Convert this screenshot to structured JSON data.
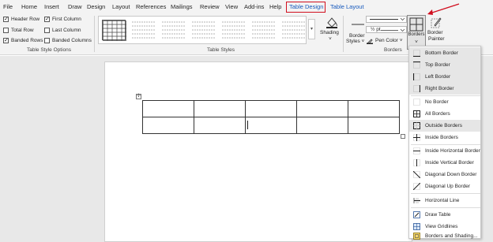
{
  "menu": {
    "items": [
      "File",
      "Home",
      "Insert",
      "Draw",
      "Design",
      "Layout",
      "References",
      "Mailings",
      "Review",
      "View",
      "Add-ins",
      "Help",
      "Table Design",
      "Table Layout"
    ]
  },
  "ribbon": {
    "style_options": {
      "header_row": "Header Row",
      "first_column": "First Column",
      "total_row": "Total Row",
      "last_column": "Last Column",
      "banded_rows": "Banded Rows",
      "banded_columns": "Banded Columns",
      "group_label": "Table Style Options"
    },
    "table_styles_label": "Table Styles",
    "shading_label": "Shading",
    "border_styles_label1": "Border",
    "border_styles_label2": "Styles ˅",
    "pen_weight": "½ pt",
    "pen_color_label": "Pen Color ˅",
    "borders_label": "Borders",
    "borders_btn_label": "Borders",
    "border_painter_label1": "Border",
    "border_painter_label2": "Painter",
    "borders_group_label": "Borders"
  },
  "dropdown": {
    "items": [
      {
        "label": "Bottom Border",
        "icon": "bottom-border-icon"
      },
      {
        "label": "Top Border",
        "icon": "top-border-icon"
      },
      {
        "label": "Left Border",
        "icon": "left-border-icon"
      },
      {
        "label": "Right Border",
        "icon": "right-border-icon"
      },
      {
        "label": "No Border",
        "icon": "no-border-icon"
      },
      {
        "label": "All Borders",
        "icon": "all-borders-icon"
      },
      {
        "label": "Outside Borders",
        "icon": "outside-borders-icon"
      },
      {
        "label": "Inside Borders",
        "icon": "inside-borders-icon"
      },
      {
        "label": "Inside Horizontal Border",
        "icon": "inside-horizontal-border-icon"
      },
      {
        "label": "Inside Vertical Border",
        "icon": "inside-vertical-border-icon"
      },
      {
        "label": "Diagonal Down Border",
        "icon": "diagonal-down-border-icon"
      },
      {
        "label": "Diagonal Up Border",
        "icon": "diagonal-up-border-icon"
      },
      {
        "label": "Horizontal Line",
        "icon": "horizontal-line-icon"
      },
      {
        "label": "Draw Table",
        "icon": "draw-table-icon"
      },
      {
        "label": "View Gridlines",
        "icon": "view-gridlines-icon"
      },
      {
        "label": "Borders and Shading...",
        "icon": "borders-and-shading-icon"
      }
    ]
  },
  "colors": {
    "accent": "#185abd",
    "highlight_box": "#d10f1f",
    "arrow": "#d10f1f"
  }
}
